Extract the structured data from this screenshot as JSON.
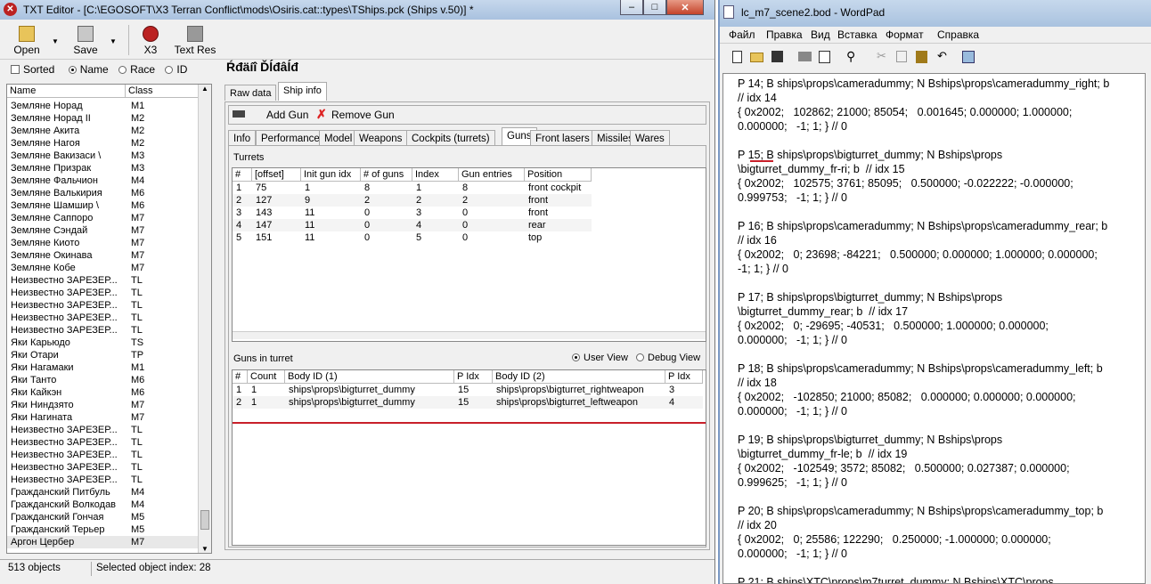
{
  "txt": {
    "title": "TXT Editor - [C:\\EGOSOFT\\X3 Terran Conflict\\mods\\Osiris.cat::types\\TShips.pck (Ships v.50)] *",
    "toolbar": [
      {
        "label": "Open",
        "icon": "open-icon"
      },
      {
        "label": "Save",
        "icon": "save-icon"
      },
      {
        "label": "X3",
        "icon": "x3-icon"
      },
      {
        "label": "Text Res",
        "icon": "text-res-icon"
      }
    ],
    "filters": {
      "sorted": "Sorted",
      "name": "Name",
      "race": "Race",
      "id": "ID"
    },
    "list_headers": [
      "Name",
      "Class"
    ],
    "list": [
      [
        "Земляне Норад",
        "M1"
      ],
      [
        "Земляне Норад II",
        "M2"
      ],
      [
        "Земляне Акита",
        "M2"
      ],
      [
        "Земляне Нагоя",
        "M2"
      ],
      [
        "Земляне Вакизаси \\",
        "M3"
      ],
      [
        "Земляне Призрак",
        "M3"
      ],
      [
        "Земляне Фальчион",
        "M4"
      ],
      [
        "Земляне Валькирия",
        "M6"
      ],
      [
        "Земляне Шамшир \\",
        "M6"
      ],
      [
        "Земляне Саппоро",
        "M7"
      ],
      [
        "Земляне Сэндай",
        "M7"
      ],
      [
        "Земляне Киото",
        "M7"
      ],
      [
        "Земляне Окинава",
        "M7"
      ],
      [
        "Земляне Кобе",
        "M7"
      ],
      [
        "Неизвестно ЗАРЕЗЕР...",
        "TL"
      ],
      [
        "Неизвестно ЗАРЕЗЕР...",
        "TL"
      ],
      [
        "Неизвестно ЗАРЕЗЕР...",
        "TL"
      ],
      [
        "Неизвестно ЗАРЕЗЕР...",
        "TL"
      ],
      [
        "Неизвестно ЗАРЕЗЕР...",
        "TL"
      ],
      [
        "Яки Карьюдо",
        "TS"
      ],
      [
        "Яки Отари",
        "TP"
      ],
      [
        "Яки Нагамаки",
        "M1"
      ],
      [
        "Яки Танто",
        "M6"
      ],
      [
        "Яки Кайкэн",
        "M6"
      ],
      [
        "Яки Ниндзято",
        "M7"
      ],
      [
        "Яки Нагината",
        "M7"
      ],
      [
        "Неизвестно ЗАРЕЗЕР...",
        "TL"
      ],
      [
        "Неизвестно ЗАРЕЗЕР...",
        "TL"
      ],
      [
        "Неизвестно ЗАРЕЗЕР...",
        "TL"
      ],
      [
        "Неизвестно ЗАРЕЗЕР...",
        "TL"
      ],
      [
        "Неизвестно ЗАРЕЗЕР...",
        "TL"
      ],
      [
        "Гражданский Питбуль",
        "M4"
      ],
      [
        "Гражданский Волкодав",
        "M4"
      ],
      [
        "Гражданский Гончая",
        "M5"
      ],
      [
        "Гражданский Терьер",
        "M5"
      ],
      [
        "Аргон Цербер",
        "M7"
      ]
    ],
    "ship_name": "Ŕđäíî Ďĺđâĺđ",
    "main_tabs": [
      "Raw data",
      "Ship info"
    ],
    "gun_actions": {
      "add": "Add Gun",
      "remove": "Remove Gun"
    },
    "sub_tabs": [
      "Info",
      "Performance",
      "Model",
      "Weapons",
      "Cockpits (turrets)",
      "Guns",
      "Front lasers",
      "Missiles",
      "Wares"
    ],
    "turrets": {
      "label": "Turrets",
      "headers": [
        "#",
        "[offset]",
        "Init gun idx",
        "# of guns",
        "Index",
        "Gun entries",
        "Position"
      ],
      "rows": [
        [
          "1",
          "75",
          "1",
          "8",
          "1",
          "8",
          "front cockpit"
        ],
        [
          "2",
          "127",
          "9",
          "2",
          "2",
          "2",
          "front"
        ],
        [
          "3",
          "143",
          "11",
          "0",
          "3",
          "0",
          "front"
        ],
        [
          "4",
          "147",
          "11",
          "0",
          "4",
          "0",
          "rear"
        ],
        [
          "5",
          "151",
          "11",
          "0",
          "5",
          "0",
          "top"
        ]
      ]
    },
    "guns": {
      "label": "Guns in turret",
      "user_view": "User View",
      "debug_view": "Debug View",
      "headers": [
        "#",
        "Count",
        "Body ID (1)",
        "P Idx",
        "Body ID (2)",
        "P Idx"
      ],
      "rows": [
        [
          "1",
          "1",
          "ships\\props\\bigturret_dummy",
          "15",
          "ships\\props\\bigturret_rightweapon",
          "3"
        ],
        [
          "2",
          "1",
          "ships\\props\\bigturret_dummy",
          "15",
          "ships\\props\\bigturret_leftweapon",
          "4"
        ]
      ]
    },
    "status": {
      "count": "513 objects",
      "selected": "Selected object index: 28"
    }
  },
  "wordpad": {
    "title": "lc_m7_scene2.bod - WordPad",
    "menu": [
      "Файл",
      "Правка",
      "Вид",
      "Вставка",
      "Формат",
      "Справка"
    ],
    "lines": [
      "P 14; B ships\\props\\cameradummy; N Bships\\props\\cameradummy_right; b",
      "// idx 14",
      "{ 0x2002;   102862; 21000; 85054;   0.001645; 0.000000; 1.000000;",
      "0.000000;   -1; 1; } // 0",
      "",
      "P 15; B ships\\props\\bigturret_dummy; N Bships\\props",
      "\\bigturret_dummy_fr-ri; b  // idx 15",
      "{ 0x2002;   102575; 3761; 85095;   0.500000; -0.022222; -0.000000;",
      "0.999753;   -1; 1; } // 0",
      "",
      "P 16; B ships\\props\\cameradummy; N Bships\\props\\cameradummy_rear; b",
      "// idx 16",
      "{ 0x2002;   0; 23698; -84221;   0.500000; 0.000000; 1.000000; 0.000000;",
      "-1; 1; } // 0",
      "",
      "P 17; B ships\\props\\bigturret_dummy; N Bships\\props",
      "\\bigturret_dummy_rear; b  // idx 17",
      "{ 0x2002;   0; -29695; -40531;   0.500000; 1.000000; 0.000000;",
      "0.000000;   -1; 1; } // 0",
      "",
      "P 18; B ships\\props\\cameradummy; N Bships\\props\\cameradummy_left; b",
      "// idx 18",
      "{ 0x2002;   -102850; 21000; 85082;   0.000000; 0.000000; 0.000000;",
      "0.000000;   -1; 1; } // 0",
      "",
      "P 19; B ships\\props\\bigturret_dummy; N Bships\\props",
      "\\bigturret_dummy_fr-le; b  // idx 19",
      "{ 0x2002;   -102549; 3572; 85082;   0.500000; 0.027387; 0.000000;",
      "0.999625;   -1; 1; } // 0",
      "",
      "P 20; B ships\\props\\cameradummy; N Bships\\props\\cameradummy_top; b",
      "// idx 20",
      "{ 0x2002;   0; 25586; 122290;   0.250000; -1.000000; 0.000000;",
      "0.000000;   -1; 1; } // 0",
      "",
      "P 21; B ships\\XTC\\props\\m7turret_dummy; N Bships\\XTC\\props"
    ]
  }
}
